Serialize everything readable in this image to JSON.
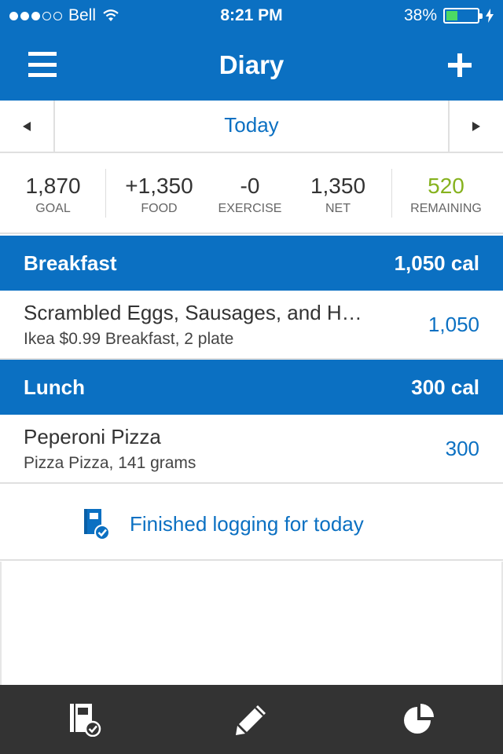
{
  "status_bar": {
    "carrier": "Bell",
    "signal_icon": "signal-dots-icon",
    "wifi_icon": "wifi-icon",
    "time": "8:21 PM",
    "battery_percent": "38%",
    "battery_level": 0.38,
    "charging_icon": "bolt-icon"
  },
  "nav": {
    "menu_icon": "hamburger-menu-icon",
    "title": "Diary",
    "add_icon": "plus-icon"
  },
  "date": {
    "prev_icon": "left-triangle-icon",
    "label": "Today",
    "next_icon": "right-triangle-icon"
  },
  "summary": {
    "goal": {
      "value": "1,870",
      "label": "GOAL"
    },
    "food": {
      "value": "+1,350",
      "label": "FOOD"
    },
    "exercise": {
      "value": "-0",
      "label": "EXERCISE"
    },
    "net": {
      "value": "1,350",
      "label": "NET"
    },
    "remaining": {
      "value": "520",
      "label": "REMAINING"
    }
  },
  "meals": {
    "breakfast": {
      "name": "Breakfast",
      "calories": "1,050 cal",
      "entry": {
        "title": "Scrambled Eggs, Sausages, and H…",
        "detail": "Ikea $0.99 Breakfast, 2 plate",
        "calories": "1,050"
      }
    },
    "lunch": {
      "name": "Lunch",
      "calories": "300 cal",
      "entry": {
        "title": "Peperoni Pizza",
        "detail": "Pizza Pizza, 141 grams",
        "calories": "300"
      }
    }
  },
  "finished": {
    "icon": "diary-check-icon",
    "label": "Finished logging for today"
  },
  "tabbar": {
    "tabs": [
      {
        "icon": "diary-check-icon"
      },
      {
        "icon": "pencil-icon"
      },
      {
        "icon": "pie-chart-icon"
      }
    ]
  },
  "colors": {
    "brand_blue": "#0b70c2",
    "remaining_green": "#86b21e",
    "tabbar_bg": "#333333"
  }
}
